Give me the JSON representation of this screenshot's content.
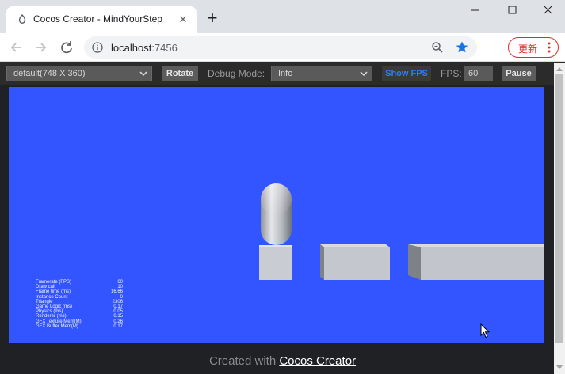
{
  "browser": {
    "tab_title": "Cocos Creator - MindYourStep",
    "url_host": "localhost",
    "url_port": ":7456",
    "update_label": "更新"
  },
  "preview": {
    "device_select": "default(748 X 360)",
    "rotate_label": "Rotate",
    "debug_mode_label": "Debug Mode:",
    "debug_mode_value": "Info",
    "show_fps_label": "Show FPS",
    "fps_label": "FPS:",
    "fps_value": "60",
    "pause_label": "Pause"
  },
  "scene": {
    "background_color": "#3355ff",
    "stats": [
      {
        "label": "Framerate (FPS)",
        "value": "60"
      },
      {
        "label": "Draw call",
        "value": "10"
      },
      {
        "label": "Frame time (ms)",
        "value": "16.66"
      },
      {
        "label": "Instance Count",
        "value": "0"
      },
      {
        "label": "Triangle",
        "value": "2306"
      },
      {
        "label": "Game Logic (ms)",
        "value": "0.17"
      },
      {
        "label": "Physics (ms)",
        "value": "0.05"
      },
      {
        "label": "Renderer (ms)",
        "value": "0.15"
      },
      {
        "label": "GFX Texture Mem(M)",
        "value": "0.26"
      },
      {
        "label": "GFX Buffer Mem(M)",
        "value": "0.17"
      }
    ]
  },
  "footer": {
    "prefix": "Created with ",
    "link": "Cocos Creator"
  }
}
